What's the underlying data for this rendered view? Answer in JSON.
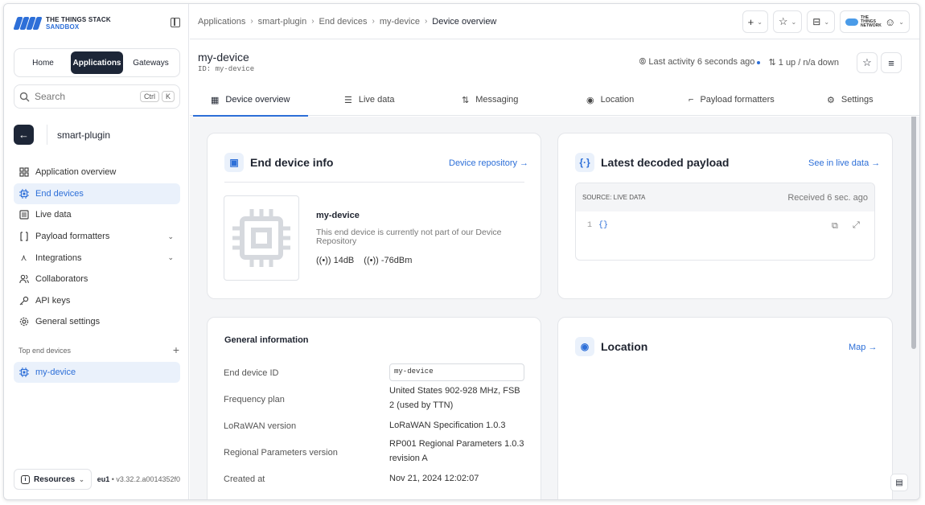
{
  "brand": {
    "line1": "THE THINGS STACK",
    "line2": "SANDBOX",
    "accent": "#2d6fd8"
  },
  "switcher": [
    "Home",
    "Applications",
    "Gateways"
  ],
  "search": {
    "placeholder": "Search",
    "key1": "Ctrl",
    "key2": "K"
  },
  "app": {
    "name": "smart-plugin"
  },
  "nav": [
    {
      "label": "Application overview",
      "icon": "grid-icon"
    },
    {
      "label": "End devices",
      "icon": "chip-icon"
    },
    {
      "label": "Live data",
      "icon": "list-icon"
    },
    {
      "label": "Payload formatters",
      "icon": "code-icon"
    },
    {
      "label": "Integrations",
      "icon": "integration-icon"
    },
    {
      "label": "Collaborators",
      "icon": "people-icon"
    },
    {
      "label": "API keys",
      "icon": "key-icon"
    },
    {
      "label": "General settings",
      "icon": "gear-icon"
    }
  ],
  "top_devices": {
    "label": "Top end devices",
    "item": "my-device"
  },
  "footer": {
    "resources": "Resources",
    "region": "eu1",
    "version": "v3.32.2.a0014352f0"
  },
  "breadcrumbs": [
    "Applications",
    "smart-plugin",
    "End devices",
    "my-device",
    "Device overview"
  ],
  "network_logo": "THE THINGS NETWORK",
  "device": {
    "title": "my-device",
    "id_line": "ID: my-device",
    "activity": "Last activity 6 seconds ago",
    "counts": "1 up / n/a down"
  },
  "tabs": [
    "Device overview",
    "Live data",
    "Messaging",
    "Location",
    "Payload formatters",
    "Settings"
  ],
  "info_card": {
    "title": "End device info",
    "link": "Device repository →",
    "name": "my-device",
    "desc": "This end device is currently not part of our Device Repository",
    "signal1": "14dB",
    "signal2": "-76dBm"
  },
  "payload_card": {
    "title": "Latest decoded payload",
    "link": "See in live data →",
    "source": "SOURCE: LIVE DATA",
    "received": "Received 6 sec. ago",
    "line_no": "1",
    "body": "{}"
  },
  "general": {
    "title": "General information",
    "rows": [
      {
        "label": "End device ID",
        "value": "my-device"
      },
      {
        "label": "Frequency plan",
        "value": "United States 902-928 MHz, FSB 2 (used by TTN)"
      },
      {
        "label": "LoRaWAN version",
        "value": "LoRaWAN Specification 1.0.3"
      },
      {
        "label": "Regional Parameters version",
        "value": "RP001 Regional Parameters 1.0.3 revision A"
      },
      {
        "label": "Created at",
        "value": "Nov 21, 2024 12:02:07"
      }
    ]
  },
  "location_card": {
    "title": "Location",
    "link": "Map →"
  }
}
